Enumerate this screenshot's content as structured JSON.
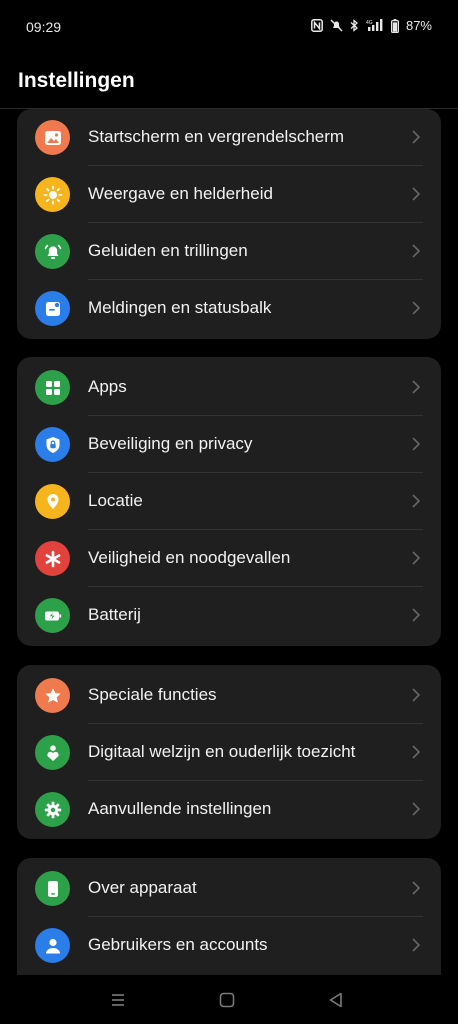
{
  "status": {
    "time": "09:29",
    "battery": "87%"
  },
  "header": {
    "title": "Instellingen"
  },
  "groups": [
    {
      "items": [
        {
          "label": "Startscherm en vergrendelscherm",
          "icon": "image-icon",
          "color": "#ee7a4e"
        },
        {
          "label": "Weergave en helderheid",
          "icon": "brightness-icon",
          "color": "#f6b51c"
        },
        {
          "label": "Geluiden en trillingen",
          "icon": "bell-icon",
          "color": "#2da04a"
        },
        {
          "label": "Meldingen en statusbalk",
          "icon": "notification-icon",
          "color": "#2b7de9"
        }
      ]
    },
    {
      "items": [
        {
          "label": "Apps",
          "icon": "apps-grid-icon",
          "color": "#2da04a"
        },
        {
          "label": "Beveiliging en privacy",
          "icon": "shield-lock-icon",
          "color": "#2b7de9"
        },
        {
          "label": "Locatie",
          "icon": "location-pin-icon",
          "color": "#f6b51c"
        },
        {
          "label": "Veiligheid en noodgevallen",
          "icon": "asterisk-icon",
          "color": "#e2423c"
        },
        {
          "label": "Batterij",
          "icon": "battery-icon",
          "color": "#2da04a"
        }
      ]
    },
    {
      "items": [
        {
          "label": "Speciale functies",
          "icon": "star-icon",
          "color": "#ee7a4e"
        },
        {
          "label": "Digitaal welzijn en ouderlijk toezicht",
          "icon": "wellbeing-icon",
          "color": "#2da04a"
        },
        {
          "label": "Aanvullende instellingen",
          "icon": "gear-icon",
          "color": "#2da04a"
        }
      ]
    },
    {
      "items": [
        {
          "label": "Over apparaat",
          "icon": "phone-icon",
          "color": "#2da04a"
        },
        {
          "label": "Gebruikers en accounts",
          "icon": "user-icon",
          "color": "#2b7de9"
        }
      ]
    }
  ]
}
